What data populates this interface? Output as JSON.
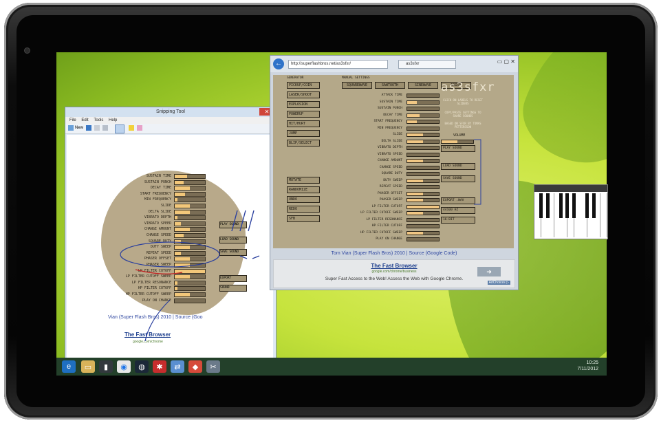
{
  "snipping_tool": {
    "title": "Snipping Tool",
    "menu": [
      "File",
      "Edit",
      "Tools",
      "Help"
    ],
    "new_label": "New",
    "params": [
      {
        "label": "SUSTAIN TIME",
        "value": 0.4
      },
      {
        "label": "SUSTAIN PUNCH",
        "value": 0.3
      },
      {
        "label": "DECAY TIME",
        "value": 0.5
      },
      {
        "label": "START FREQUENCY",
        "value": 0.35
      },
      {
        "label": "MIN FREQUENCY",
        "value": 0.1
      },
      {
        "label": "SLIDE",
        "value": 0.5
      },
      {
        "label": "DELTA SLIDE",
        "value": 0.5
      },
      {
        "label": "VIBRATO DEPTH",
        "value": 0.1
      },
      {
        "label": "VIBRATO SPEED",
        "value": 0.2
      },
      {
        "label": "CHANGE AMOUNT",
        "value": 0.5
      },
      {
        "label": "CHANGE SPEED",
        "value": 0.3
      },
      {
        "label": "SQUARE DUTY",
        "value": 0.2
      },
      {
        "label": "DUTY SWEEP",
        "value": 0.5
      },
      {
        "label": "REPEAT SPEED",
        "value": 0.2
      },
      {
        "label": "PHASER OFFSET",
        "value": 0.5
      },
      {
        "label": "PHASER SWEEP",
        "value": 0.5
      },
      {
        "label": "LP FILTER CUTOFF",
        "value": 1.0
      },
      {
        "label": "LP FILTER CUTOFF SWEEP",
        "value": 0.5
      },
      {
        "label": "LP FILTER RESONANCE",
        "value": 0.1
      },
      {
        "label": "HP FILTER CUTOFF",
        "value": 0.1
      },
      {
        "label": "HP FILTER CUTOFF SWEEP",
        "value": 0.5
      },
      {
        "label": "PLAY ON CHANGE",
        "value": 0
      }
    ],
    "side_buttons": [
      "PLAY SOUND",
      "LOAD SOUND",
      "SAVE SOUND",
      "EXPORT",
      "SOUND"
    ],
    "credit": "Vian (Super Flash Bros) 2010 | Source (Goo",
    "ad_title": "The Fast Browser",
    "ad_url": "google.com/chrome"
  },
  "browser": {
    "url": "http://superflashbros.net/as3sfxr/",
    "tab": "as3sfxr",
    "back_label": "←"
  },
  "sfxr": {
    "section_generator": "GENERATOR",
    "section_manual": "MANUAL SETTINGS",
    "generators": [
      "PICKUP/COIN",
      "LASER/SHOOT",
      "EXPLOSION",
      "POWERUP",
      "HIT/HURT",
      "JUMP",
      "BLIP/SELECT",
      "MUTATE",
      "RANDOMIZE",
      "UNDO",
      "REDO",
      "SFB"
    ],
    "waveforms": [
      "SQUAREWAVE",
      "SAWTOOTH",
      "SINEWAVE",
      "NOISE"
    ],
    "logo": "as3sfxr",
    "hint1": "CLICK ON LABELS TO RESET SLIDERS",
    "hint2": "COPY/PASTE SETTINGS TO SHARE SOUNDS",
    "hint3": "BASED ON SFXR BY TOMAS PETTERSSON",
    "volume_label": "VOLUME",
    "params": [
      {
        "label": "ATTACK TIME",
        "value": 0.0
      },
      {
        "label": "SUSTAIN TIME",
        "value": 0.3
      },
      {
        "label": "SUSTAIN PUNCH",
        "value": 0.0
      },
      {
        "label": "DECAY TIME",
        "value": 0.4
      },
      {
        "label": "START FREQUENCY",
        "value": 0.3
      },
      {
        "label": "MIN FREQUENCY",
        "value": 0.0
      },
      {
        "label": "SLIDE",
        "value": 0.5
      },
      {
        "label": "DELTA SLIDE",
        "value": 0.5
      },
      {
        "label": "VIBRATO DEPTH",
        "value": 0.0
      },
      {
        "label": "VIBRATO SPEED",
        "value": 0.0
      },
      {
        "label": "CHANGE AMOUNT",
        "value": 0.5
      },
      {
        "label": "CHANGE SPEED",
        "value": 0.0
      },
      {
        "label": "SQUARE DUTY",
        "value": 0.0
      },
      {
        "label": "DUTY SWEEP",
        "value": 0.5
      },
      {
        "label": "REPEAT SPEED",
        "value": 0.0
      },
      {
        "label": "PHASER OFFSET",
        "value": 0.5
      },
      {
        "label": "PHASER SWEEP",
        "value": 0.5
      },
      {
        "label": "LP FILTER CUTOFF",
        "value": 1.0
      },
      {
        "label": "LP FILTER CUTOFF SWEEP",
        "value": 0.5
      },
      {
        "label": "LP FILTER RESONANCE",
        "value": 0.0
      },
      {
        "label": "HP FILTER CUTOFF",
        "value": 0.0
      },
      {
        "label": "HP FILTER CUTOFF SWEEP",
        "value": 0.5
      },
      {
        "label": "PLAY ON CHANGE",
        "value": 0
      }
    ],
    "right_buttons": [
      "PLAY SOUND",
      "LOAD SOUND",
      "SAVE SOUND",
      "EXPORT .WAV",
      "44100 HZ",
      "16-BIT"
    ],
    "credit": "Tom Vian (Super Flash Bros) 2010 | Source (Google Code)",
    "ad_title": "The Fast Browser",
    "ad_url": "google.com/chrome/business",
    "ad_text": "Super Fast Access to the Web! Access the Web with Google Chrome.",
    "ad_choices": "AdChoices ▷"
  },
  "taskbar": {
    "clock_time": "10:25",
    "clock_date": "7/11/2012"
  },
  "colors": {
    "sfxr_bg": "#b4a889",
    "slider_fill": "#f1c784",
    "desktop_green": "#c6e33c",
    "taskbar": "#23402a"
  }
}
